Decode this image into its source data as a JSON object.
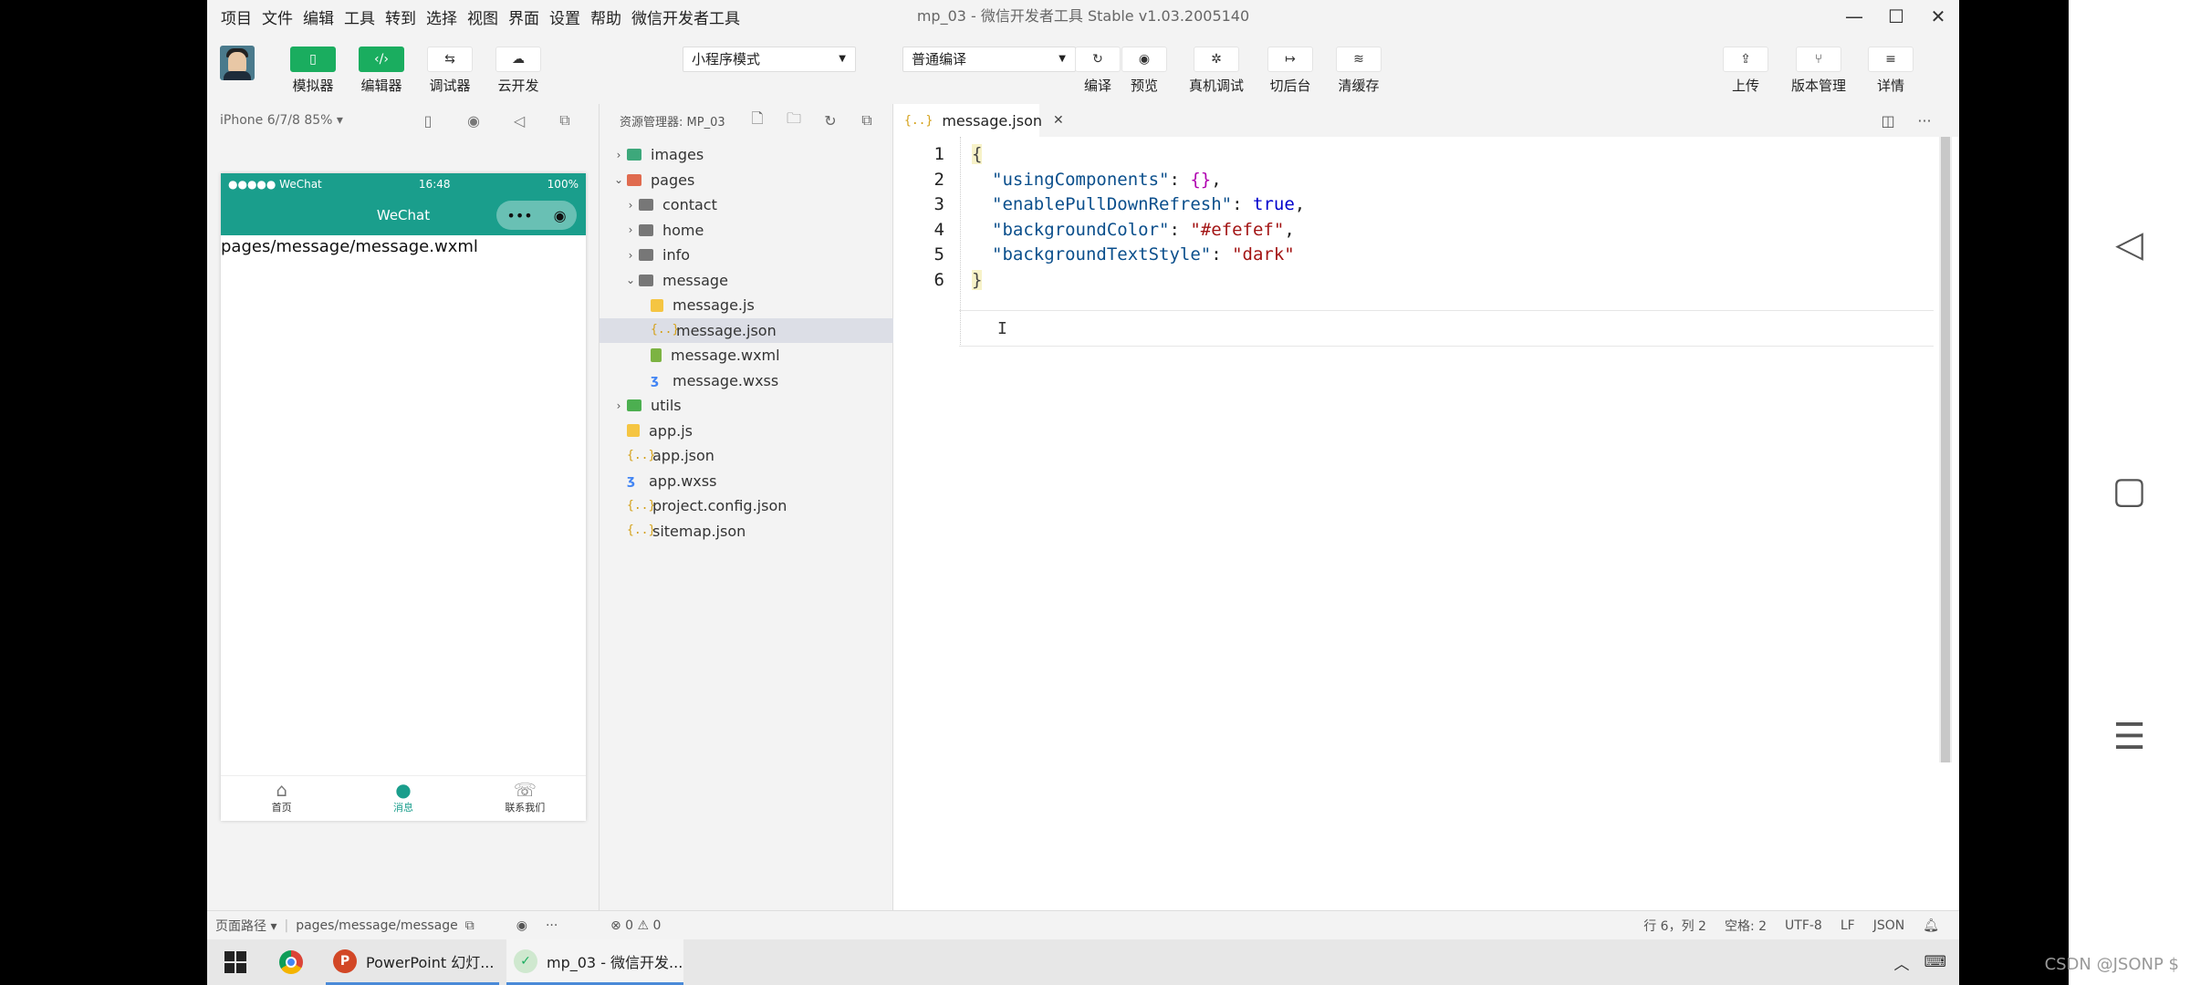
{
  "window": {
    "title": "mp_03 - 微信开发者工具 Stable v1.03.2005140",
    "menu": [
      "项目",
      "文件",
      "编辑",
      "工具",
      "转到",
      "选择",
      "视图",
      "界面",
      "设置",
      "帮助",
      "微信开发者工具"
    ],
    "controls": {
      "minimize": "—",
      "maximize": "☐",
      "close": "✕"
    }
  },
  "toolbar": {
    "simulator": "模拟器",
    "editor": "编辑器",
    "debugger": "调试器",
    "cloud": "云开发",
    "mode_select": "小程序模式",
    "compile_select": "普通编译",
    "compile": "编译",
    "preview": "预览",
    "remote_debug": "真机调试",
    "background": "切后台",
    "clear_cache": "清缓存",
    "upload": "上传",
    "version": "版本管理",
    "details": "详情"
  },
  "simulator": {
    "device": "iPhone 6/7/8 85% ▾",
    "status_left": "●●●●● WeChat",
    "status_time": "16:48",
    "status_right": "100%",
    "nav_title": "WeChat",
    "page_text": "pages/message/message.wxml",
    "tabs": [
      {
        "label": "首页",
        "icon": "⌂"
      },
      {
        "label": "消息",
        "icon": "●"
      },
      {
        "label": "联系我们",
        "icon": "☏"
      }
    ]
  },
  "explorer": {
    "title": "资源管理器: MP_03",
    "items": [
      {
        "name": "images",
        "depth": 0,
        "arrow": "›",
        "kind": "img"
      },
      {
        "name": "pages",
        "depth": 0,
        "arrow": "⌄",
        "kind": "pages"
      },
      {
        "name": "contact",
        "depth": 1,
        "arrow": "›",
        "kind": "folder"
      },
      {
        "name": "home",
        "depth": 1,
        "arrow": "›",
        "kind": "folder"
      },
      {
        "name": "info",
        "depth": 1,
        "arrow": "›",
        "kind": "folder"
      },
      {
        "name": "message",
        "depth": 1,
        "arrow": "⌄",
        "kind": "folder"
      },
      {
        "name": "message.js",
        "depth": 2,
        "arrow": "",
        "kind": "js"
      },
      {
        "name": "message.json",
        "depth": 2,
        "arrow": "",
        "kind": "json",
        "selected": true
      },
      {
        "name": "message.wxml",
        "depth": 2,
        "arrow": "",
        "kind": "wxml"
      },
      {
        "name": "message.wxss",
        "depth": 2,
        "arrow": "",
        "kind": "wxss"
      },
      {
        "name": "utils",
        "depth": 0,
        "arrow": "›",
        "kind": "utils"
      },
      {
        "name": "app.js",
        "depth": 0,
        "arrow": "",
        "kind": "js"
      },
      {
        "name": "app.json",
        "depth": 0,
        "arrow": "",
        "kind": "json"
      },
      {
        "name": "app.wxss",
        "depth": 0,
        "arrow": "",
        "kind": "wxss"
      },
      {
        "name": "project.config.json",
        "depth": 0,
        "arrow": "",
        "kind": "json"
      },
      {
        "name": "sitemap.json",
        "depth": 0,
        "arrow": "",
        "kind": "json"
      }
    ]
  },
  "editor": {
    "tab_label": "message.json",
    "tab_icon": "{..}",
    "lines": [
      {
        "num": "1",
        "open_brace": "{"
      },
      {
        "num": "2",
        "key": "\"usingComponents\"",
        "sep": ": ",
        "val": "{}",
        "end": ","
      },
      {
        "num": "3",
        "key": "\"enablePullDownRefresh\"",
        "sep": ": ",
        "val": "true",
        "end": ","
      },
      {
        "num": "4",
        "key": "\"backgroundColor\"",
        "sep": ": ",
        "val": "\"#efefef\"",
        "end": ","
      },
      {
        "num": "5",
        "key": "\"backgroundTextStyle\"",
        "sep": ": ",
        "val": "\"dark\"",
        "end": ""
      },
      {
        "num": "6",
        "close_brace": "}"
      }
    ]
  },
  "statusbar": {
    "page_path_label": "页面路径 ▾",
    "page_path": "pages/message/message",
    "problems": "⊗ 0 ⚠ 0",
    "cursor_pos": "行 6，列 2",
    "indent": "空格: 2",
    "encoding": "UTF-8",
    "eol": "LF",
    "language": "JSON"
  },
  "taskbar": {
    "ppt_label": "PowerPoint 幻灯...",
    "devtools_label": "mp_03 - 微信开发..."
  },
  "watermark": "CSDN @JSONP $"
}
